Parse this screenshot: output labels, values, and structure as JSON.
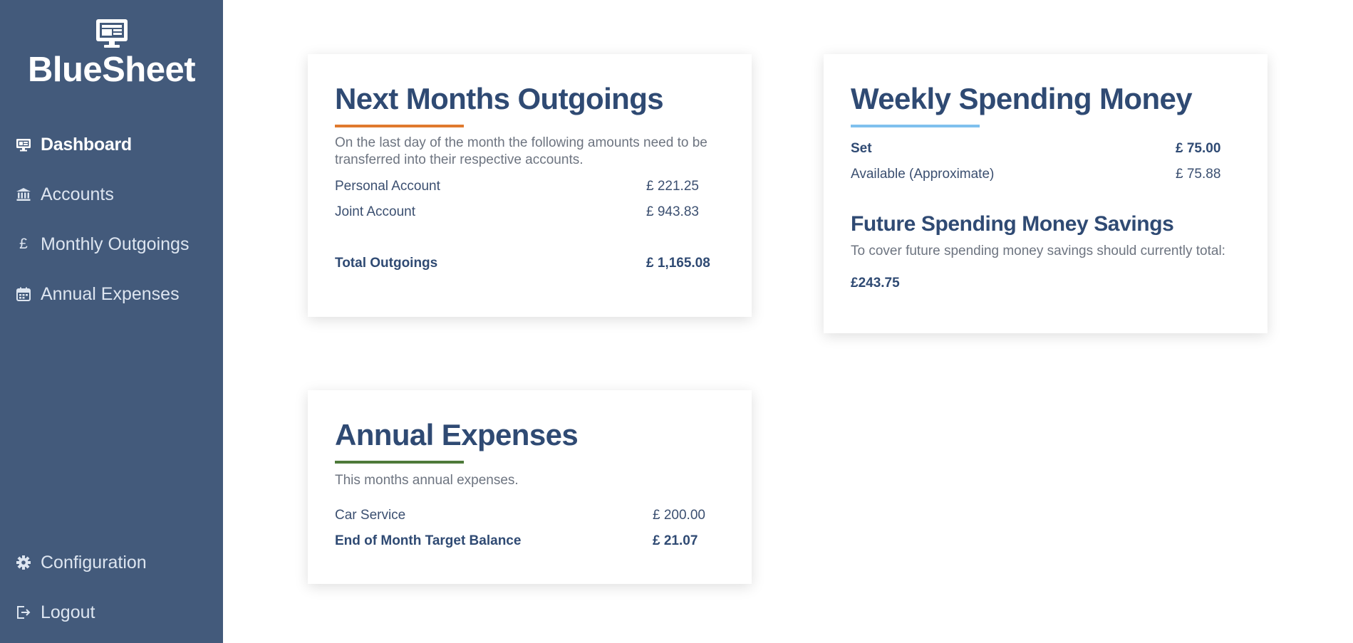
{
  "app": {
    "name": "BlueSheet"
  },
  "sidebar": {
    "items": [
      {
        "label": "Dashboard",
        "icon": "desktop-icon"
      },
      {
        "label": "Accounts",
        "icon": "bank-icon"
      },
      {
        "label": "Monthly Outgoings",
        "icon": "pound-icon"
      },
      {
        "label": "Annual Expenses",
        "icon": "calendar-icon"
      }
    ],
    "bottom_items": [
      {
        "label": "Configuration",
        "icon": "gear-icon"
      },
      {
        "label": "Logout",
        "icon": "logout-icon"
      }
    ]
  },
  "outgoings": {
    "title": "Next Months Outgoings",
    "accent": "#e07a2e",
    "description": "On the last day of the month the following amounts need to be transferred into their respective accounts.",
    "rows": [
      {
        "label": "Personal Account",
        "value": "£ 221.25"
      },
      {
        "label": "Joint Account",
        "value": "£ 943.83"
      }
    ],
    "total_label": "Total Outgoings",
    "total_value": "£ 1,165.08"
  },
  "weekly": {
    "title": "Weekly Spending Money",
    "accent": "#7fc0ee",
    "set_label": "Set",
    "set_value": "£ 75.00",
    "available_label": "Available (Approximate)",
    "available_value": "£ 75.88",
    "savings_title": "Future Spending Money Savings",
    "savings_description": "To cover future spending money savings should currently total:",
    "savings_amount": "£243.75"
  },
  "annual": {
    "title": "Annual Expenses",
    "accent": "#4e7a3a",
    "description": "This months annual expenses.",
    "rows": [
      {
        "label": "Car Service",
        "value": "£ 200.00"
      }
    ],
    "target_label": "End of Month Target Balance",
    "target_value": "£ 21.07"
  },
  "colors": {
    "sidebar_bg": "#435a7b",
    "heading": "#2f4a73"
  }
}
